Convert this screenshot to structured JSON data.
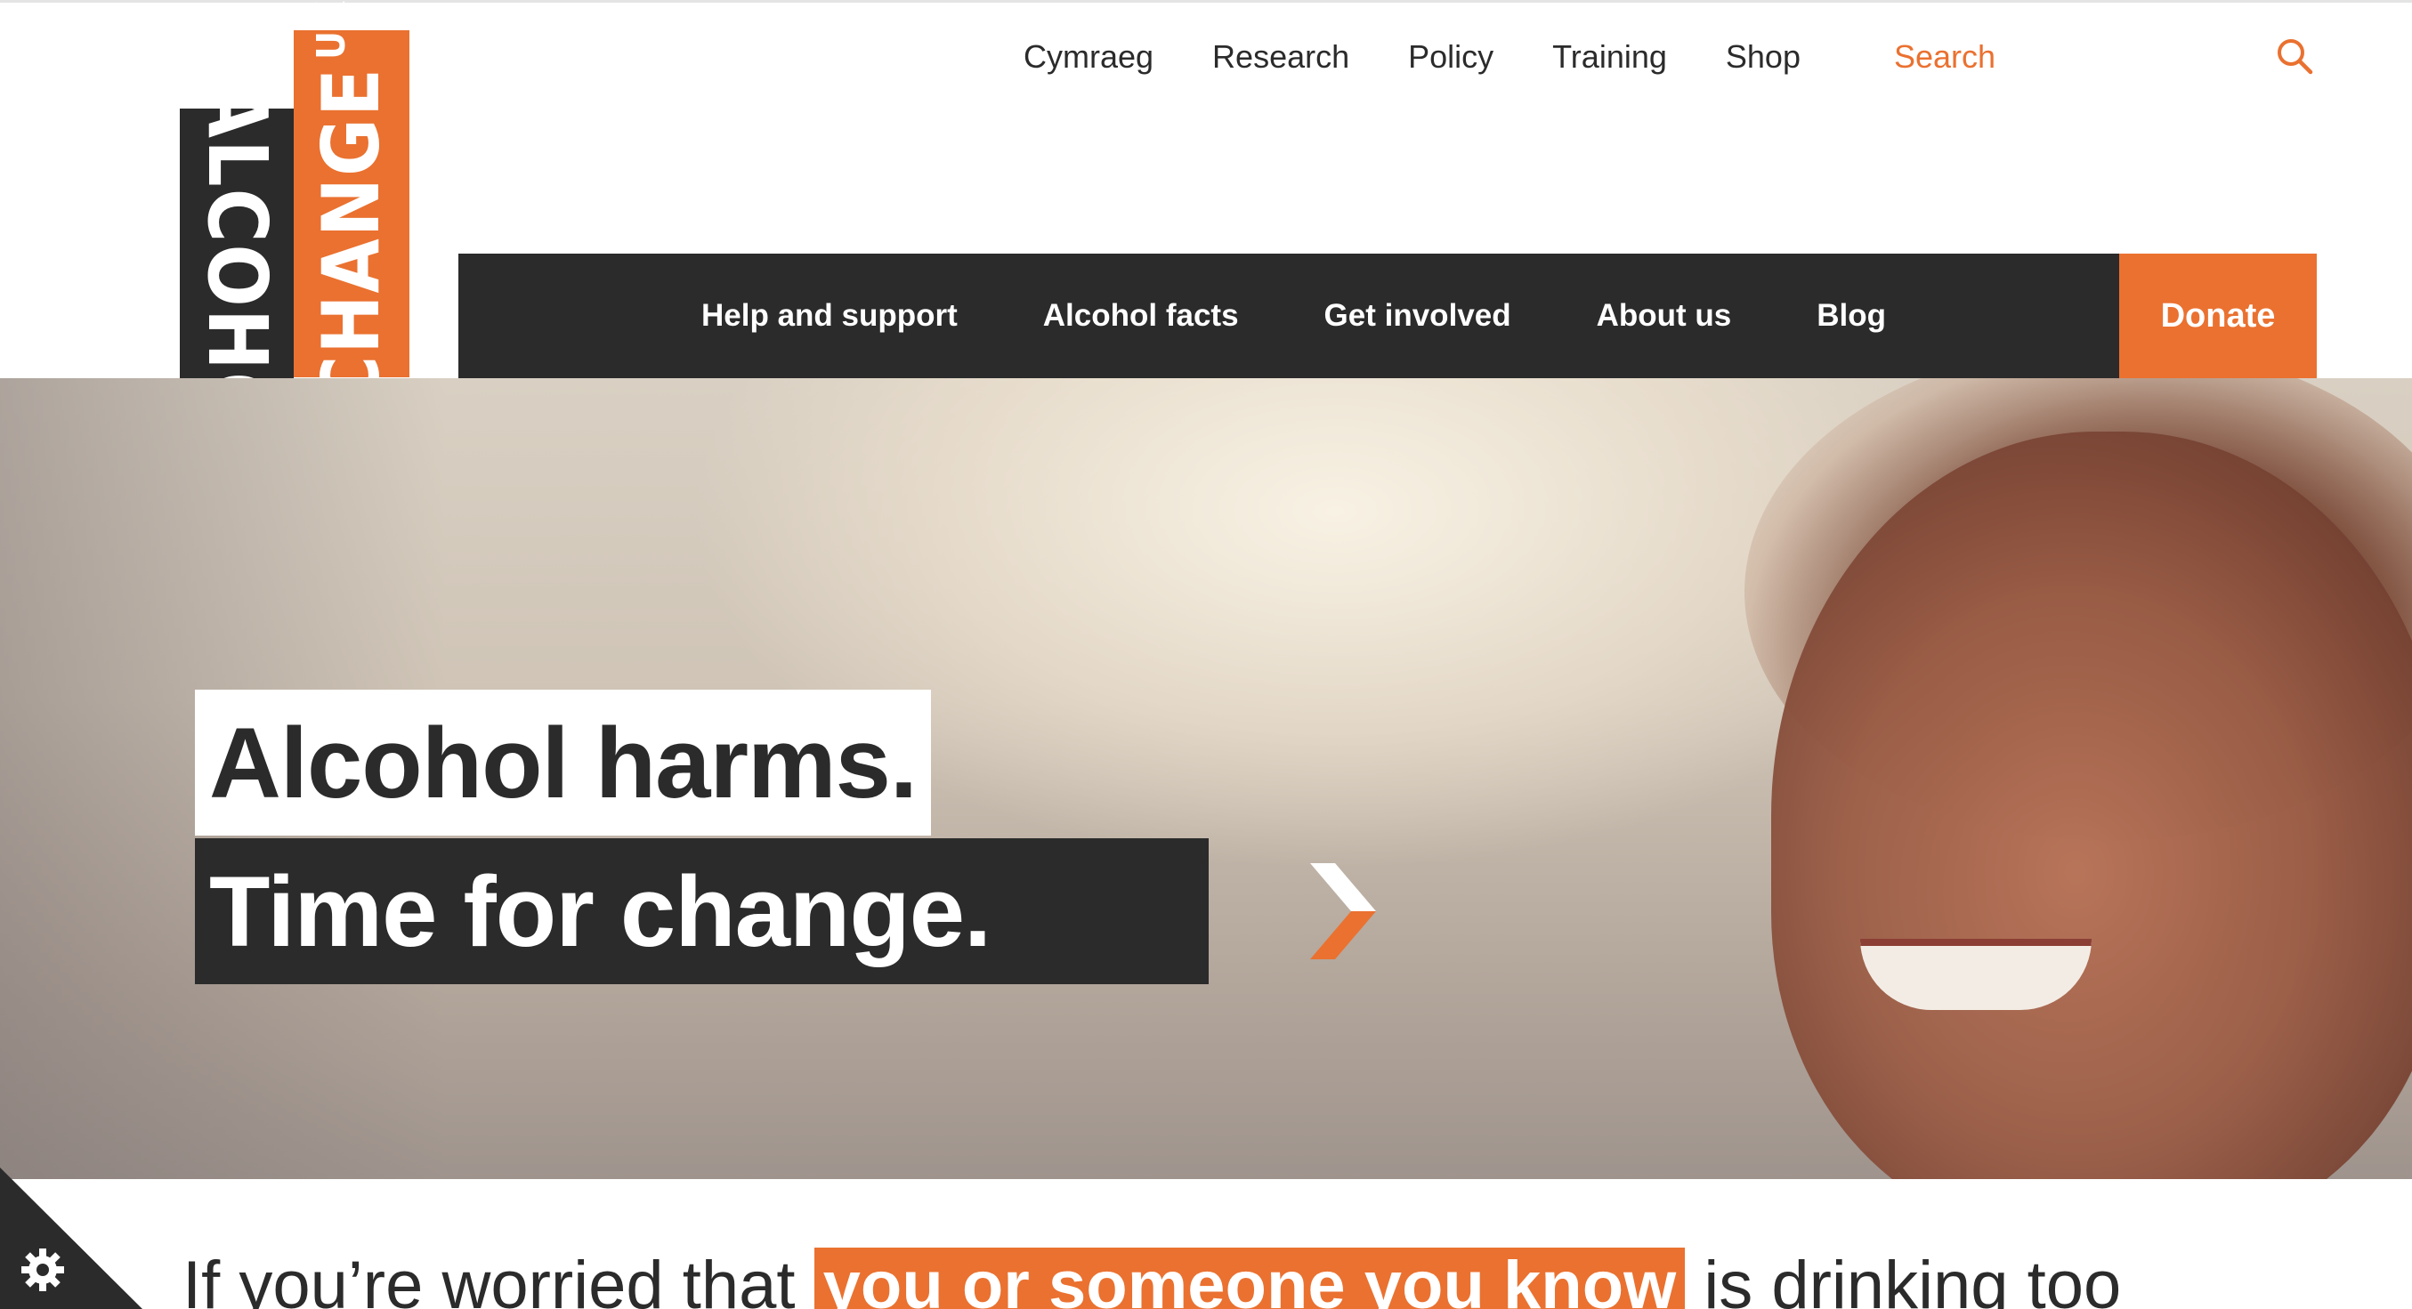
{
  "logo": {
    "alcohol": "ALCOHOL",
    "change": "CHANGE",
    "uk": "UK"
  },
  "utility_nav": {
    "items": [
      {
        "label": "Cymraeg"
      },
      {
        "label": "Research"
      },
      {
        "label": "Policy"
      },
      {
        "label": "Training"
      },
      {
        "label": "Shop"
      }
    ],
    "search_label": "Search"
  },
  "main_nav": {
    "items": [
      {
        "label": "Help and support"
      },
      {
        "label": "Alcohol facts"
      },
      {
        "label": "Get involved"
      },
      {
        "label": "About us"
      },
      {
        "label": "Blog"
      }
    ],
    "donate_label": "Donate"
  },
  "hero": {
    "headline_line1": "Alcohol harms.",
    "headline_line2": "Time for change."
  },
  "intro": {
    "before": "If you’re worried that ",
    "highlight": "you or someone you know",
    "after": " is drinking too"
  },
  "colors": {
    "accent": "#ea7130",
    "dark": "#2b2b2b",
    "background": "#ffffff"
  },
  "icons": {
    "search": "search-icon",
    "chevron": "chevron-right-icon",
    "cookie": "gear-icon"
  }
}
